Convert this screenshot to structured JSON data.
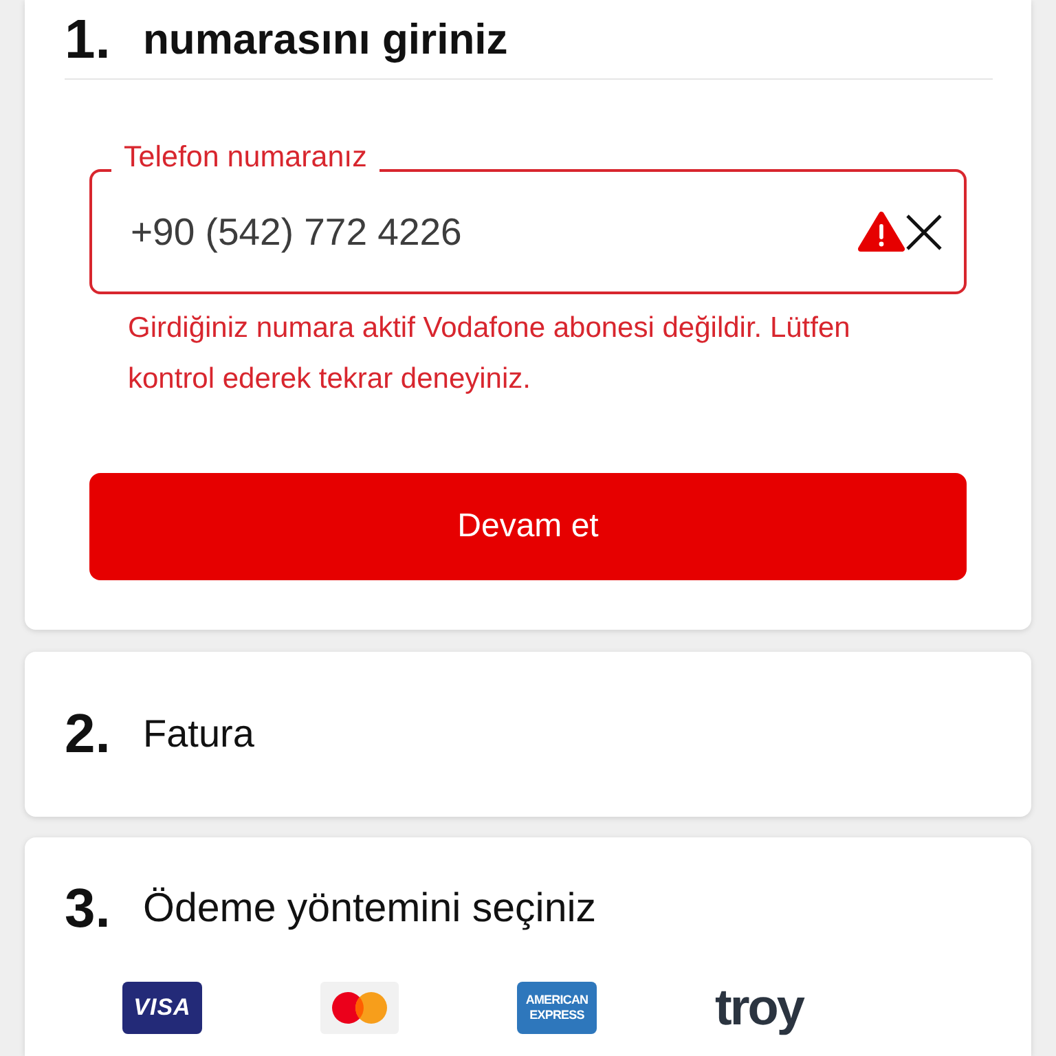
{
  "steps": [
    {
      "number": "1.",
      "title": "numarasını giriniz",
      "kind": "phone",
      "active": true,
      "field": {
        "label": "Telefon numaranız",
        "value": "+90 (542) 772 4226",
        "error": true,
        "error_message": "Girdiğiniz numara aktif Vodafone abonesi değildir. Lütfen kontrol ederek tekrar deneyiniz."
      },
      "button": "Devam et"
    },
    {
      "number": "2.",
      "title": "Fatura",
      "kind": "collapsed",
      "active": false
    },
    {
      "number": "3.",
      "title": "Ödeme yöntemini seçiniz",
      "kind": "payment",
      "active": false,
      "payment_methods": [
        {
          "kind": "visa",
          "label": "VISA"
        },
        {
          "kind": "mastercard"
        },
        {
          "kind": "amex",
          "label": "AMERICAN EXPRESS"
        },
        {
          "kind": "troy",
          "label": "troy"
        }
      ]
    }
  ]
}
